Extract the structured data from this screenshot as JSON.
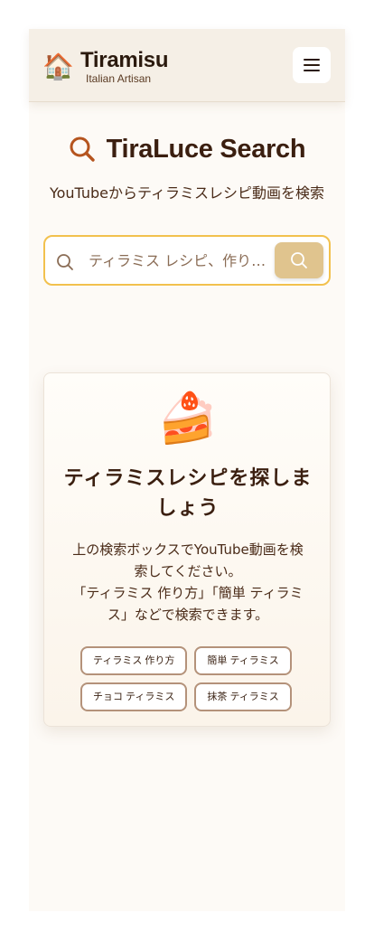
{
  "header": {
    "logo_icon": "house-icon",
    "logo_glyph": "🏠",
    "brand_title": "Tiramisu",
    "brand_subtitle": "Italian Artisan",
    "menu_icon": "hamburger-icon"
  },
  "search_section": {
    "title_icon": "search-icon",
    "title": "TiraLuce Search",
    "subtitle": "YouTubeからティラミスレシピ動画を検索",
    "input": {
      "value": "",
      "placeholder": "ティラミス レシピ、作り方..."
    },
    "submit_icon": "search-icon"
  },
  "empty_state": {
    "icon": "cake-icon",
    "icon_glyph": "🍰",
    "title": "ティラミスレシピを探しましょう",
    "description_line1": "上の検索ボックスでYouTube動画を検索してください。",
    "description_line2": "「ティラミス 作り方」「簡単 ティラミス」などで検索できます。",
    "suggestions": [
      "ティラミス 作り方",
      "簡単 ティラミス",
      "チョコ ティラミス",
      "抹茶 ティラミス"
    ]
  },
  "colors": {
    "accent": "#f2c14e",
    "search_button": "#e0c48e",
    "title_icon": "#b5541e",
    "text_primary": "#3b1f10",
    "chip_border": "#b4927a"
  }
}
